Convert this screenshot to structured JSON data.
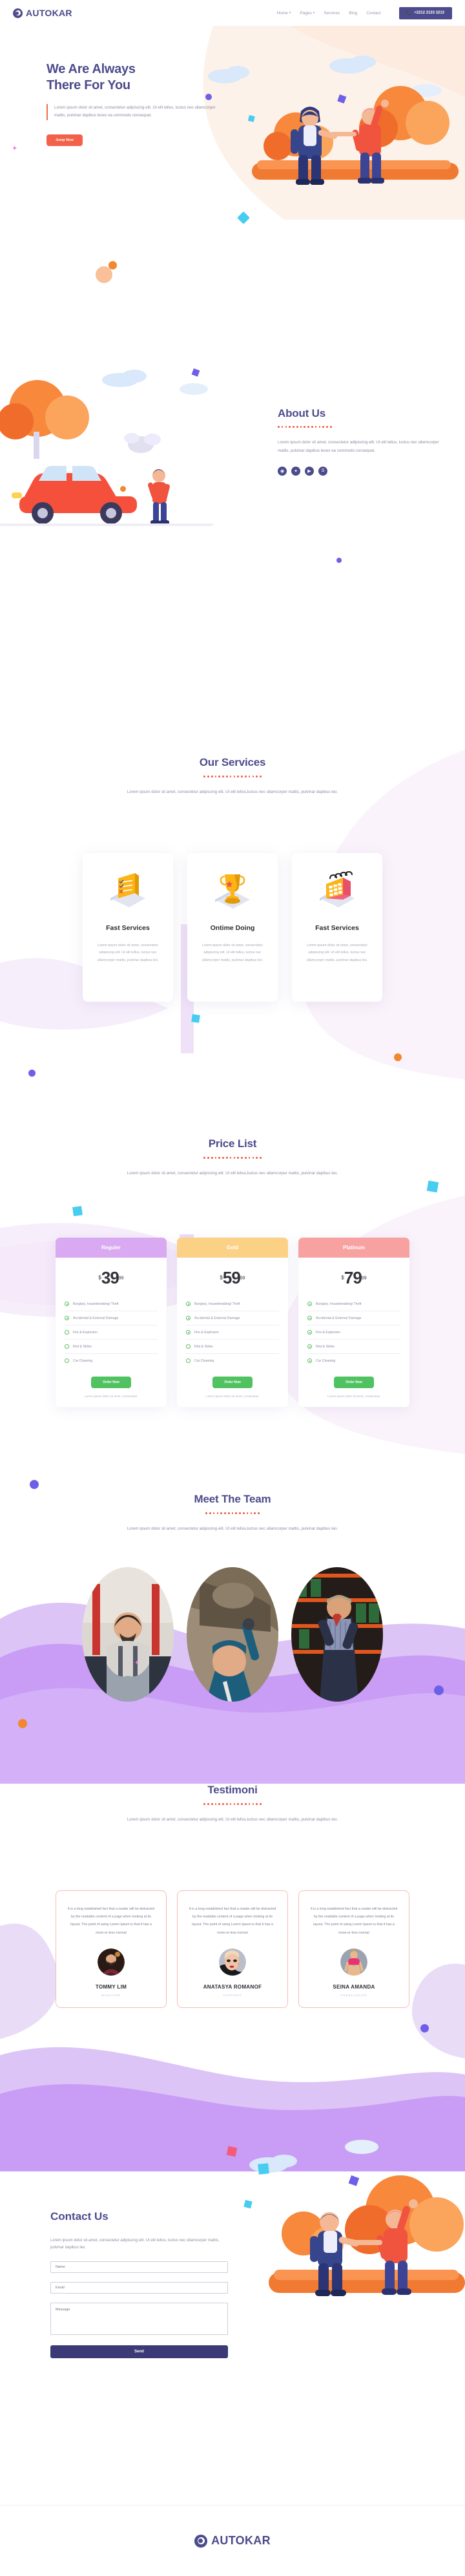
{
  "brand": {
    "name": "AUTOKAR",
    "logo_icon": "camera-lens-icon"
  },
  "header": {
    "nav": [
      {
        "label": "Home",
        "has_dropdown": true
      },
      {
        "label": "Pages",
        "has_dropdown": true
      },
      {
        "label": "Services",
        "has_dropdown": false
      },
      {
        "label": "Blog",
        "has_dropdown": false
      },
      {
        "label": "Contact",
        "has_dropdown": false
      }
    ],
    "phone_label": "+2212 2133 3213",
    "phone_icon": "phone-icon"
  },
  "hero": {
    "title_line1": "We Are Always",
    "title_line2": "There For You",
    "description": "Lorem ipsum dolor sit amet, consectetur adipiscing elit. Ut elit tellus, luctus nec ullamcorper mattis, pulvinar dapibus leoex ea commodo consequat.",
    "cta_label": "Jump Now"
  },
  "about": {
    "title": "About Us",
    "description": "Lorem ipsum dolor sit amet, consectetur adipiscing elit. Ut elit tellus, luctus nec ullamcorper mattis, pulvinar dapibus leoex ea commodo consequat.",
    "socials": [
      {
        "name": "dribbble-icon",
        "glyph": "◉"
      },
      {
        "name": "twitter-icon",
        "glyph": "🐦"
      },
      {
        "name": "youtube-icon",
        "glyph": "▶"
      },
      {
        "name": "skype-icon",
        "glyph": "S"
      }
    ]
  },
  "services": {
    "title": "Our Services",
    "subtitle": "Lorem ipsum dolor sit amet, consectetur adipiscing elit. Ut elit tellus,luctus nec ullamcorper mattis, pulvinar dapibus leo.",
    "cards": [
      {
        "icon": "checklist-icon",
        "title": "Fast Services",
        "desc": "Lorem ipsum dolor sit amet, consectetur adipiscing elit. Ut elit tellus, luctus nec ullamcorper mattis, pulvinar dapibus leo."
      },
      {
        "icon": "trophy-icon",
        "title": "Ontime Doing",
        "desc": "Lorem ipsum dolor sit amet, consectetur adipiscing elit. Ut elit tellus, luctus nec ullamcorper mattis, pulvinar dapibus leo."
      },
      {
        "icon": "calendar-icon",
        "title": "Fast Services",
        "desc": "Lorem ipsum dolor sit amet, consectetur adipiscing elit. Ut elit tellus, luctus nec ullamcorper mattis, pulvinar dapibus leo."
      }
    ]
  },
  "price": {
    "title": "Price List",
    "subtitle": "Lorem ipsum dolor sit amet, consectetur adipiscing elit. Ut elit tellus,luctus nec ullamcorper mattis, pulvinar dapibus leo.",
    "plans": [
      {
        "name": "Reguler",
        "header_color": "#d9a9f2",
        "currency": "$",
        "amount": "39",
        "cents": "99",
        "features": [
          {
            "label": "Burglary, housebreaking/ Theft",
            "enabled": true
          },
          {
            "label": "Accidental & External Damage",
            "enabled": true
          },
          {
            "label": "Fire & Explosion",
            "enabled": false
          },
          {
            "label": "Riot & Strike",
            "enabled": false
          },
          {
            "label": "Car Cleaning",
            "enabled": false
          }
        ],
        "cta": "Order Now",
        "note": "Lorem ipsum dolor sit amet, consectetur"
      },
      {
        "name": "Gold",
        "header_color": "#fbd186",
        "currency": "$",
        "amount": "59",
        "cents": "99",
        "features": [
          {
            "label": "Burglary, housebreaking/ Theft",
            "enabled": true
          },
          {
            "label": "Accidental & External Damage",
            "enabled": true
          },
          {
            "label": "Fire & Explosion",
            "enabled": true
          },
          {
            "label": "Riot & Strike",
            "enabled": false
          },
          {
            "label": "Car Cleaning",
            "enabled": false
          }
        ],
        "cta": "Order Now",
        "note": "Lorem ipsum dolor sit amet, consectetur"
      },
      {
        "name": "Platinum",
        "header_color": "#f8a1a1",
        "currency": "$",
        "amount": "79",
        "cents": "99",
        "features": [
          {
            "label": "Burglary, housebreaking/ Theft",
            "enabled": true
          },
          {
            "label": "Accidental & External Damage",
            "enabled": true
          },
          {
            "label": "Fire & Explosion",
            "enabled": true
          },
          {
            "label": "Riot & Strike",
            "enabled": true
          },
          {
            "label": "Car Cleaning",
            "enabled": true
          }
        ],
        "cta": "Order Now",
        "note": "Lorem ipsum dolor sit amet, consectetur"
      }
    ]
  },
  "team": {
    "title": "Meet The Team",
    "subtitle": "Lorem ipsum dolor sit amet, consectetur adipiscing elit. Ut elit tellus,luctus nec ullamcorper mattis, pulvinar dapibus leo.",
    "members": [
      {
        "photo": "mechanic-standing-photo"
      },
      {
        "photo": "mechanic-under-car-photo"
      },
      {
        "photo": "mechanic-warehouse-photo"
      }
    ]
  },
  "testimoni": {
    "title": "Testimoni",
    "subtitle": "Lorem ipsum dolor sit amet, consectetur adipiscing elit. Ut elit tellus,luctus nec ullamcorper mattis, pulvinar dapibus leo.",
    "items": [
      {
        "quote": "It is a long established fact that a reader will be distracted by the readable content of a page when looking at its layout. The point of using Lorem Ipsum is that it has a more-or-less normal",
        "name": "TOMMY LIM",
        "role": "MANAGER",
        "avatar": "man-portrait-photo"
      },
      {
        "quote": "It is a long established fact that a reader will be distracted by the readable content of a page when looking at its layout. The point of using Lorem Ipsum is that it has a more-or-less normal",
        "name": "ANATASYA ROMANOF",
        "role": "SUPPORT",
        "avatar": "woman-makeup-portrait-photo"
      },
      {
        "quote": "It is a long established fact that a reader will be distracted by the readable content of a page when looking at its layout. The point of using Lorem Ipsum is that it has a more-or-less normal",
        "name": "SEINA AMANDA",
        "role": "FREELANCER",
        "avatar": "woman-fitness-portrait-photo"
      }
    ]
  },
  "contact": {
    "title": "Contact Us",
    "description": "Lorem ipsum dolor sit amet, consectetur adipiscing elit. Ut elit tellus, luctus nec ullamcorper mattis, pulvinar dapibus leo.",
    "name_placeholder": "Name",
    "email_placeholder": "Email",
    "message_placeholder": "Message",
    "send_label": "Send"
  },
  "footer": {
    "brand_name": "AUTOKAR"
  },
  "colors": {
    "primary": "#4c4b8c",
    "accent_orange": "#f4614a",
    "accent_purple": "#6d5fe8",
    "accent_cyan": "#46cdf0",
    "accent_pink": "#f27de0",
    "green": "#51c262",
    "send_button": "#3b3a76"
  }
}
